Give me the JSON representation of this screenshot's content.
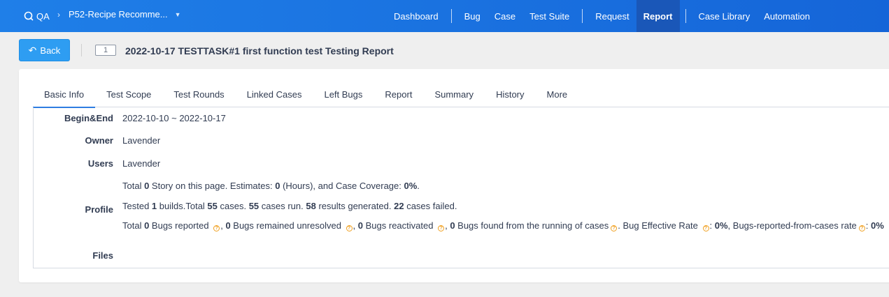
{
  "topbar": {
    "app_name": "QA",
    "product_name": "P52-Recipe Recomme...",
    "nav": [
      {
        "label": "Dashboard"
      },
      {
        "label": "Bug"
      },
      {
        "label": "Case"
      },
      {
        "label": "Test Suite"
      },
      {
        "label": "Request"
      },
      {
        "label": "Report",
        "active": true
      },
      {
        "label": "Case Library"
      },
      {
        "label": "Automation"
      }
    ]
  },
  "header": {
    "back_label": "Back",
    "id": "1",
    "title": "2022-10-17 TESTTASK#1 first function test Testing Report"
  },
  "tabs": [
    {
      "label": "Basic Info",
      "active": true
    },
    {
      "label": "Test Scope"
    },
    {
      "label": "Test Rounds"
    },
    {
      "label": "Linked Cases"
    },
    {
      "label": "Left Bugs"
    },
    {
      "label": "Report"
    },
    {
      "label": "Summary"
    },
    {
      "label": "History"
    },
    {
      "label": "More"
    }
  ],
  "info": {
    "begin_end_label": "Begin&End",
    "begin_end_value": "2022-10-10 ~ 2022-10-17",
    "owner_label": "Owner",
    "owner_value": "Lavender",
    "users_label": "Users",
    "users_value": "Lavender",
    "profile_label": "Profile",
    "files_label": "Files",
    "profile": {
      "line1": {
        "t1": "Total ",
        "story_count": "0",
        "t2": " Story on this page. Estimates: ",
        "estimates": "0",
        "t3": " (Hours), and Case Coverage: ",
        "coverage": "0%",
        "t4": "."
      },
      "line2": {
        "t1": "Tested ",
        "builds": "1",
        "t2": " builds.Total ",
        "cases_total": "55",
        "t3": " cases. ",
        "cases_run": "55",
        "t4": " cases run. ",
        "results": "58",
        "t5": " results generated. ",
        "failed": "22",
        "t6": " cases failed."
      },
      "line3": {
        "t1": "Total ",
        "bugs_reported": "0",
        "t2": " Bugs reported ",
        "t3": ", ",
        "bugs_unresolved": "0",
        "t4": " Bugs remained unresolved ",
        "t5": ", ",
        "bugs_reactivated": "0",
        "t6": " Bugs reactivated ",
        "t7": ", ",
        "bugs_from_cases": "0",
        "t8": " Bugs found from the running of cases",
        "t9": ". Bug Effective Rate ",
        "effective_rate": "0%",
        "t10": ",  Bugs-reported-from-cases rate",
        "from_cases_rate": "0%"
      }
    }
  },
  "colors": {
    "topbar": "#1f7fe8",
    "accent": "#2e9df2",
    "help_icon": "#f0a020"
  },
  "icons": {
    "brand": "qa-search-icon",
    "back": "undo-arrow-icon",
    "help": "question-circle-icon"
  }
}
